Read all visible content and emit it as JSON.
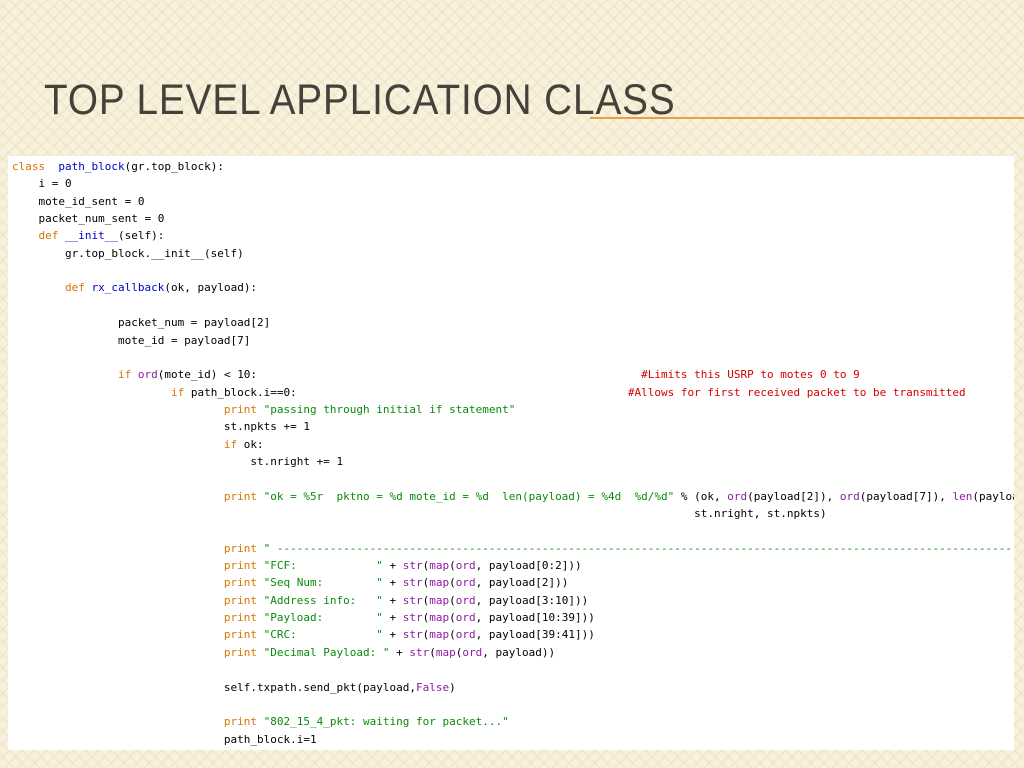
{
  "slide": {
    "title": "TOP LEVEL APPLICATION CLASS",
    "accent_color": "#e3a340"
  },
  "code": {
    "lines": [
      [
        [
          "kw",
          "class"
        ],
        [
          "",
          "  "
        ],
        [
          "fn",
          "path_block"
        ],
        [
          "",
          "(gr.top_block):"
        ]
      ],
      [
        [
          "",
          "    i = 0"
        ]
      ],
      [
        [
          "",
          "    mote_id_sent = 0"
        ]
      ],
      [
        [
          "",
          "    packet_num_sent = 0"
        ]
      ],
      [
        [
          "",
          "    "
        ],
        [
          "kw",
          "def"
        ],
        [
          "",
          " "
        ],
        [
          "fn",
          "__init__"
        ],
        [
          "",
          "(self):"
        ]
      ],
      [
        [
          "",
          "        gr.top_block.__init__(self)"
        ]
      ],
      [],
      [
        [
          "",
          "        "
        ],
        [
          "kw",
          "def"
        ],
        [
          "",
          " "
        ],
        [
          "fn",
          "rx_callback"
        ],
        [
          "",
          "(ok, payload):"
        ]
      ],
      [],
      [
        [
          "",
          "                packet_num = payload[2]"
        ]
      ],
      [
        [
          "",
          "                mote_id = payload[7]"
        ]
      ],
      [],
      [
        [
          "",
          "                "
        ],
        [
          "kw",
          "if"
        ],
        [
          "",
          " "
        ],
        [
          "bi",
          "ord"
        ],
        [
          "",
          "(mote_id) < 10:                                                          "
        ],
        [
          "cm",
          "#Limits this USRP to motes 0 to 9"
        ]
      ],
      [
        [
          "",
          "                        "
        ],
        [
          "kw",
          "if"
        ],
        [
          "",
          " path_block.i==0:                                                  "
        ],
        [
          "cm",
          "#Allows for first received packet to be transmitted"
        ]
      ],
      [
        [
          "",
          "                                "
        ],
        [
          "kw",
          "print"
        ],
        [
          "",
          " "
        ],
        [
          "st",
          "\"passing through initial if statement\""
        ]
      ],
      [
        [
          "",
          "                                st.npkts += 1"
        ]
      ],
      [
        [
          "",
          "                                "
        ],
        [
          "kw",
          "if"
        ],
        [
          "",
          " ok:"
        ]
      ],
      [
        [
          "",
          "                                    st.nright += 1"
        ]
      ],
      [],
      [
        [
          "",
          "                                "
        ],
        [
          "kw",
          "print"
        ],
        [
          "",
          " "
        ],
        [
          "st",
          "\"ok = %5r  pktno = %d mote_id = %d  len(payload) = %4d  %d/%d\""
        ],
        [
          "",
          " % (ok, "
        ],
        [
          "bi",
          "ord"
        ],
        [
          "",
          "(payload[2]), "
        ],
        [
          "bi",
          "ord"
        ],
        [
          "",
          "(payload[7]), "
        ],
        [
          "bi",
          "len"
        ],
        [
          "",
          "(payload),"
        ]
      ],
      [
        [
          "",
          "                                                                                                       st.nright, st.npkts)"
        ]
      ],
      [],
      [
        [
          "",
          "                                "
        ],
        [
          "kw",
          "print"
        ],
        [
          "",
          " "
        ],
        [
          "st",
          "\" -----------------------------------------------------------------------------------------------------------------------\""
        ]
      ],
      [
        [
          "",
          "                                "
        ],
        [
          "kw",
          "print"
        ],
        [
          "",
          " "
        ],
        [
          "st",
          "\"FCF:            \""
        ],
        [
          "",
          " + "
        ],
        [
          "bi",
          "str"
        ],
        [
          "",
          "("
        ],
        [
          "bi",
          "map"
        ],
        [
          "",
          "("
        ],
        [
          "bi",
          "ord"
        ],
        [
          "",
          ", payload[0:2]))"
        ]
      ],
      [
        [
          "",
          "                                "
        ],
        [
          "kw",
          "print"
        ],
        [
          "",
          " "
        ],
        [
          "st",
          "\"Seq Num:        \""
        ],
        [
          "",
          " + "
        ],
        [
          "bi",
          "str"
        ],
        [
          "",
          "("
        ],
        [
          "bi",
          "map"
        ],
        [
          "",
          "("
        ],
        [
          "bi",
          "ord"
        ],
        [
          "",
          ", payload[2]))"
        ]
      ],
      [
        [
          "",
          "                                "
        ],
        [
          "kw",
          "print"
        ],
        [
          "",
          " "
        ],
        [
          "st",
          "\"Address info:   \""
        ],
        [
          "",
          " + "
        ],
        [
          "bi",
          "str"
        ],
        [
          "",
          "("
        ],
        [
          "bi",
          "map"
        ],
        [
          "",
          "("
        ],
        [
          "bi",
          "ord"
        ],
        [
          "",
          ", payload[3:10]))"
        ]
      ],
      [
        [
          "",
          "                                "
        ],
        [
          "kw",
          "print"
        ],
        [
          "",
          " "
        ],
        [
          "st",
          "\"Payload:        \""
        ],
        [
          "",
          " + "
        ],
        [
          "bi",
          "str"
        ],
        [
          "",
          "("
        ],
        [
          "bi",
          "map"
        ],
        [
          "",
          "("
        ],
        [
          "bi",
          "ord"
        ],
        [
          "",
          ", payload[10:39]))"
        ]
      ],
      [
        [
          "",
          "                                "
        ],
        [
          "kw",
          "print"
        ],
        [
          "",
          " "
        ],
        [
          "st",
          "\"CRC:            \""
        ],
        [
          "",
          " + "
        ],
        [
          "bi",
          "str"
        ],
        [
          "",
          "("
        ],
        [
          "bi",
          "map"
        ],
        [
          "",
          "("
        ],
        [
          "bi",
          "ord"
        ],
        [
          "",
          ", payload[39:41]))"
        ]
      ],
      [
        [
          "",
          "                                "
        ],
        [
          "kw",
          "print"
        ],
        [
          "",
          " "
        ],
        [
          "st",
          "\"Decimal Payload: \""
        ],
        [
          "",
          " + "
        ],
        [
          "bi",
          "str"
        ],
        [
          "",
          "("
        ],
        [
          "bi",
          "map"
        ],
        [
          "",
          "("
        ],
        [
          "bi",
          "ord"
        ],
        [
          "",
          ", payload))"
        ]
      ],
      [],
      [
        [
          "",
          "                                self.txpath.send_pkt(payload,"
        ],
        [
          "bi",
          "False"
        ],
        [
          "",
          ")"
        ]
      ],
      [],
      [
        [
          "",
          "                                "
        ],
        [
          "kw",
          "print"
        ],
        [
          "",
          " "
        ],
        [
          "st",
          "\"802_15_4_pkt: waiting for packet...\""
        ]
      ],
      [
        [
          "",
          "                                path_block.i=1"
        ]
      ]
    ]
  }
}
